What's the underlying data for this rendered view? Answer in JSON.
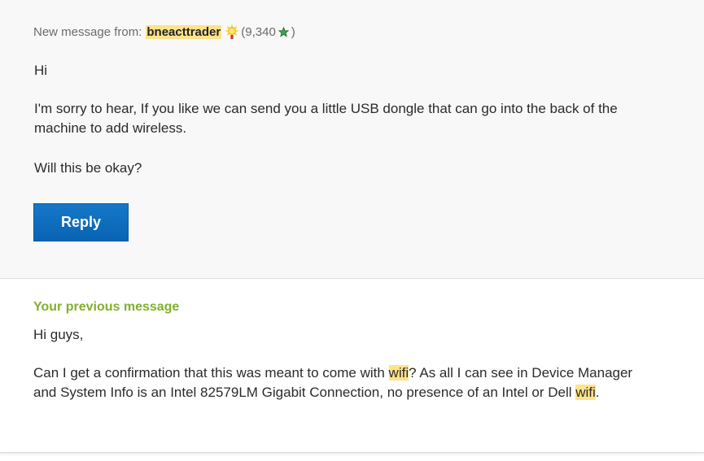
{
  "message": {
    "from_label": "New message from:",
    "username": "bneacttrader",
    "kudos_prefix": "(9,340",
    "kudos_suffix": ")",
    "rank_icon": "sun-medal-icon",
    "kudos_icon": "star-icon",
    "greeting": "Hi",
    "paragraph_1": "I'm sorry to hear, If you like we can send you a little USB dongle that can go into the back of the machine to add wireless.",
    "paragraph_2": "Will this be okay?",
    "reply_label": "Reply"
  },
  "previous": {
    "heading": "Your previous message",
    "greeting": "Hi guys,",
    "p_part1": "Can I get a confirmation that this was meant to come with ",
    "p_hl1": "wifi",
    "p_part2": "? As all I can see in Device Manager and System Info is an Intel 82579LM Gigabit Connection, no presence of an Intel or Dell ",
    "p_hl2": "wifi",
    "p_part3": "."
  },
  "colors": {
    "highlight": "#ffe28a",
    "heading_green": "#83b02a",
    "reply_blue": "#0a63b3",
    "card_bg": "#f8f8f8"
  }
}
